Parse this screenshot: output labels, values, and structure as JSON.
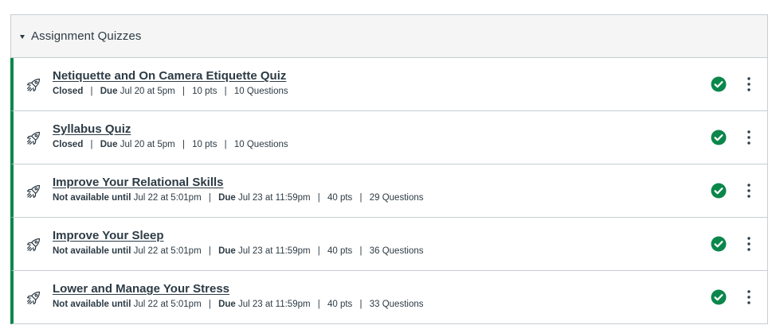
{
  "group": {
    "title": "Assignment Quizzes",
    "caret_icon": "caret-down-icon",
    "accent_color": "#0b874b"
  },
  "items": [
    {
      "title": "Netiquette and On Camera Etiquette Quiz",
      "icon": "rocket-icon",
      "status_label": "Closed",
      "availability_value": "",
      "due_label": "Due",
      "due_value": "Jul 20 at 5pm",
      "points": "10 pts",
      "questions": "10 Questions",
      "published_icon": "check-circle-icon",
      "menu_icon": "kebab-menu-icon"
    },
    {
      "title": "Syllabus Quiz",
      "icon": "rocket-icon",
      "status_label": "Closed",
      "availability_value": "",
      "due_label": "Due",
      "due_value": "Jul 20 at 5pm",
      "points": "10 pts",
      "questions": "10 Questions",
      "published_icon": "check-circle-icon",
      "menu_icon": "kebab-menu-icon"
    },
    {
      "title": "Improve Your Relational Skills",
      "icon": "rocket-icon",
      "status_label": "Not available until",
      "availability_value": "Jul 22 at 5:01pm",
      "due_label": "Due",
      "due_value": "Jul 23 at 11:59pm",
      "points": "40 pts",
      "questions": "29 Questions",
      "published_icon": "check-circle-icon",
      "menu_icon": "kebab-menu-icon"
    },
    {
      "title": "Improve Your Sleep",
      "icon": "rocket-icon",
      "status_label": "Not available until",
      "availability_value": "Jul 22 at 5:01pm",
      "due_label": "Due",
      "due_value": "Jul 23 at 11:59pm",
      "points": "40 pts",
      "questions": "36 Questions",
      "published_icon": "check-circle-icon",
      "menu_icon": "kebab-menu-icon"
    },
    {
      "title": "Lower and Manage Your Stress",
      "icon": "rocket-icon",
      "status_label": "Not available until",
      "availability_value": "Jul 22 at 5:01pm",
      "due_label": "Due",
      "due_value": "Jul 23 at 11:59pm",
      "points": "40 pts",
      "questions": "33 Questions",
      "published_icon": "check-circle-icon",
      "menu_icon": "kebab-menu-icon"
    }
  ]
}
